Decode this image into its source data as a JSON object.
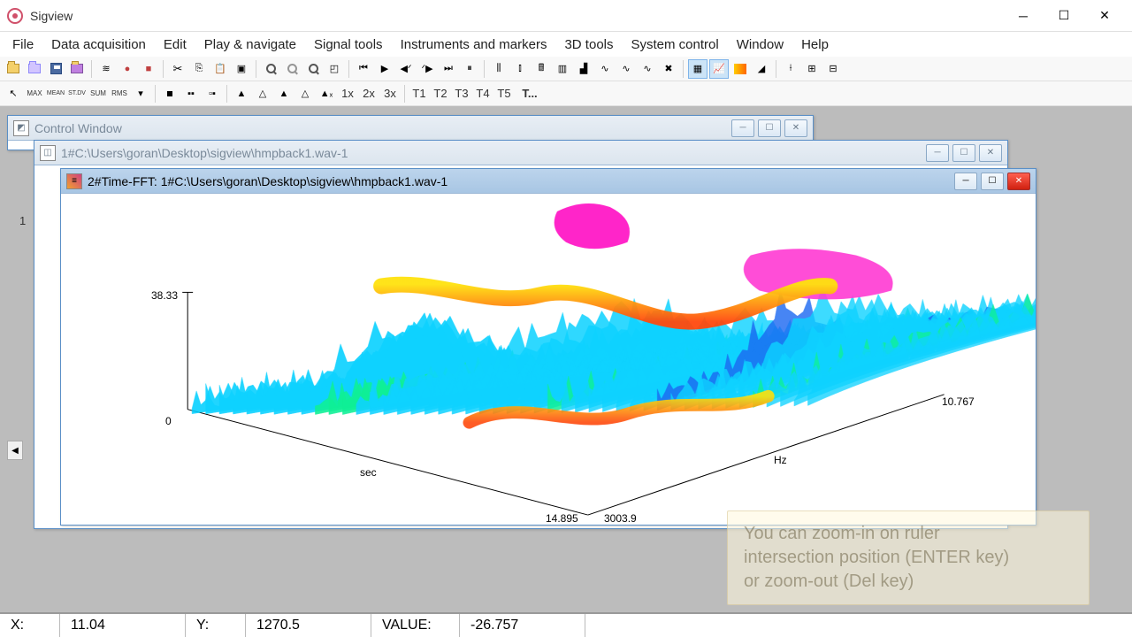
{
  "app": {
    "title": "Sigview"
  },
  "menu": {
    "items": [
      "File",
      "Data acquisition",
      "Edit",
      "Play & navigate",
      "Signal tools",
      "Instruments and markers",
      "3D tools",
      "System control",
      "Window",
      "Help"
    ]
  },
  "toolbar2_labels": {
    "t1": "T1",
    "t2": "T2",
    "t3": "T3",
    "t4": "T4",
    "t5": "T5",
    "tmore": "T...",
    "x1": "1x",
    "x2": "2x",
    "x3": "3x",
    "max": "MAX",
    "mean": "MEAN",
    "stdev": "ST.DV",
    "sum": "SUM",
    "rms": "RMS"
  },
  "windows": {
    "control": {
      "title": "Control Window",
      "row_label": "1"
    },
    "signal": {
      "title": "1#C:\\Users\\goran\\Desktop\\sigview\\hmpback1.wav-1"
    },
    "fft": {
      "title": "2#Time-FFT:  1#C:\\Users\\goran\\Desktop\\sigview\\hmpback1.wav-1"
    }
  },
  "chart_data": {
    "type": "surface-3d",
    "title": "Time-FFT Spectrogram",
    "x_axis": {
      "label": "sec",
      "min": 0,
      "max": 14.895
    },
    "y_axis": {
      "label": "Hz",
      "min": 0,
      "max": 3003.9,
      "far_tick": 10.767
    },
    "z_axis": {
      "label": "",
      "min": 0,
      "max": 38.33
    },
    "axis_text": {
      "z_max": "38.33",
      "z_min": "0",
      "x_max": "14.895",
      "y_max": "3003.9",
      "y_far": "10.767",
      "x_label": "sec",
      "y_label": "Hz"
    },
    "colormap": [
      "#00ffa0",
      "#00e0ff",
      "#2060ff",
      "#6020e0",
      "#c000c0",
      "#ff00a0",
      "#ff5020",
      "#ffc000"
    ],
    "note": "3D waterfall spectrogram of humpback whale audio; ridges of high magnitude (red/orange/yellow) trace harmonics sweeping across time near mid-frequency band; low-frequency floor is green/cyan."
  },
  "tooltip": {
    "line1": "You can zoom-in on ruler",
    "line2": "intersection position (ENTER key)",
    "line3": "or zoom-out (Del key)"
  },
  "status": {
    "x_label": "X:",
    "x_value": "11.04",
    "y_label": "Y:",
    "y_value": "1270.5",
    "v_label": "VALUE:",
    "v_value": "-26.757"
  }
}
